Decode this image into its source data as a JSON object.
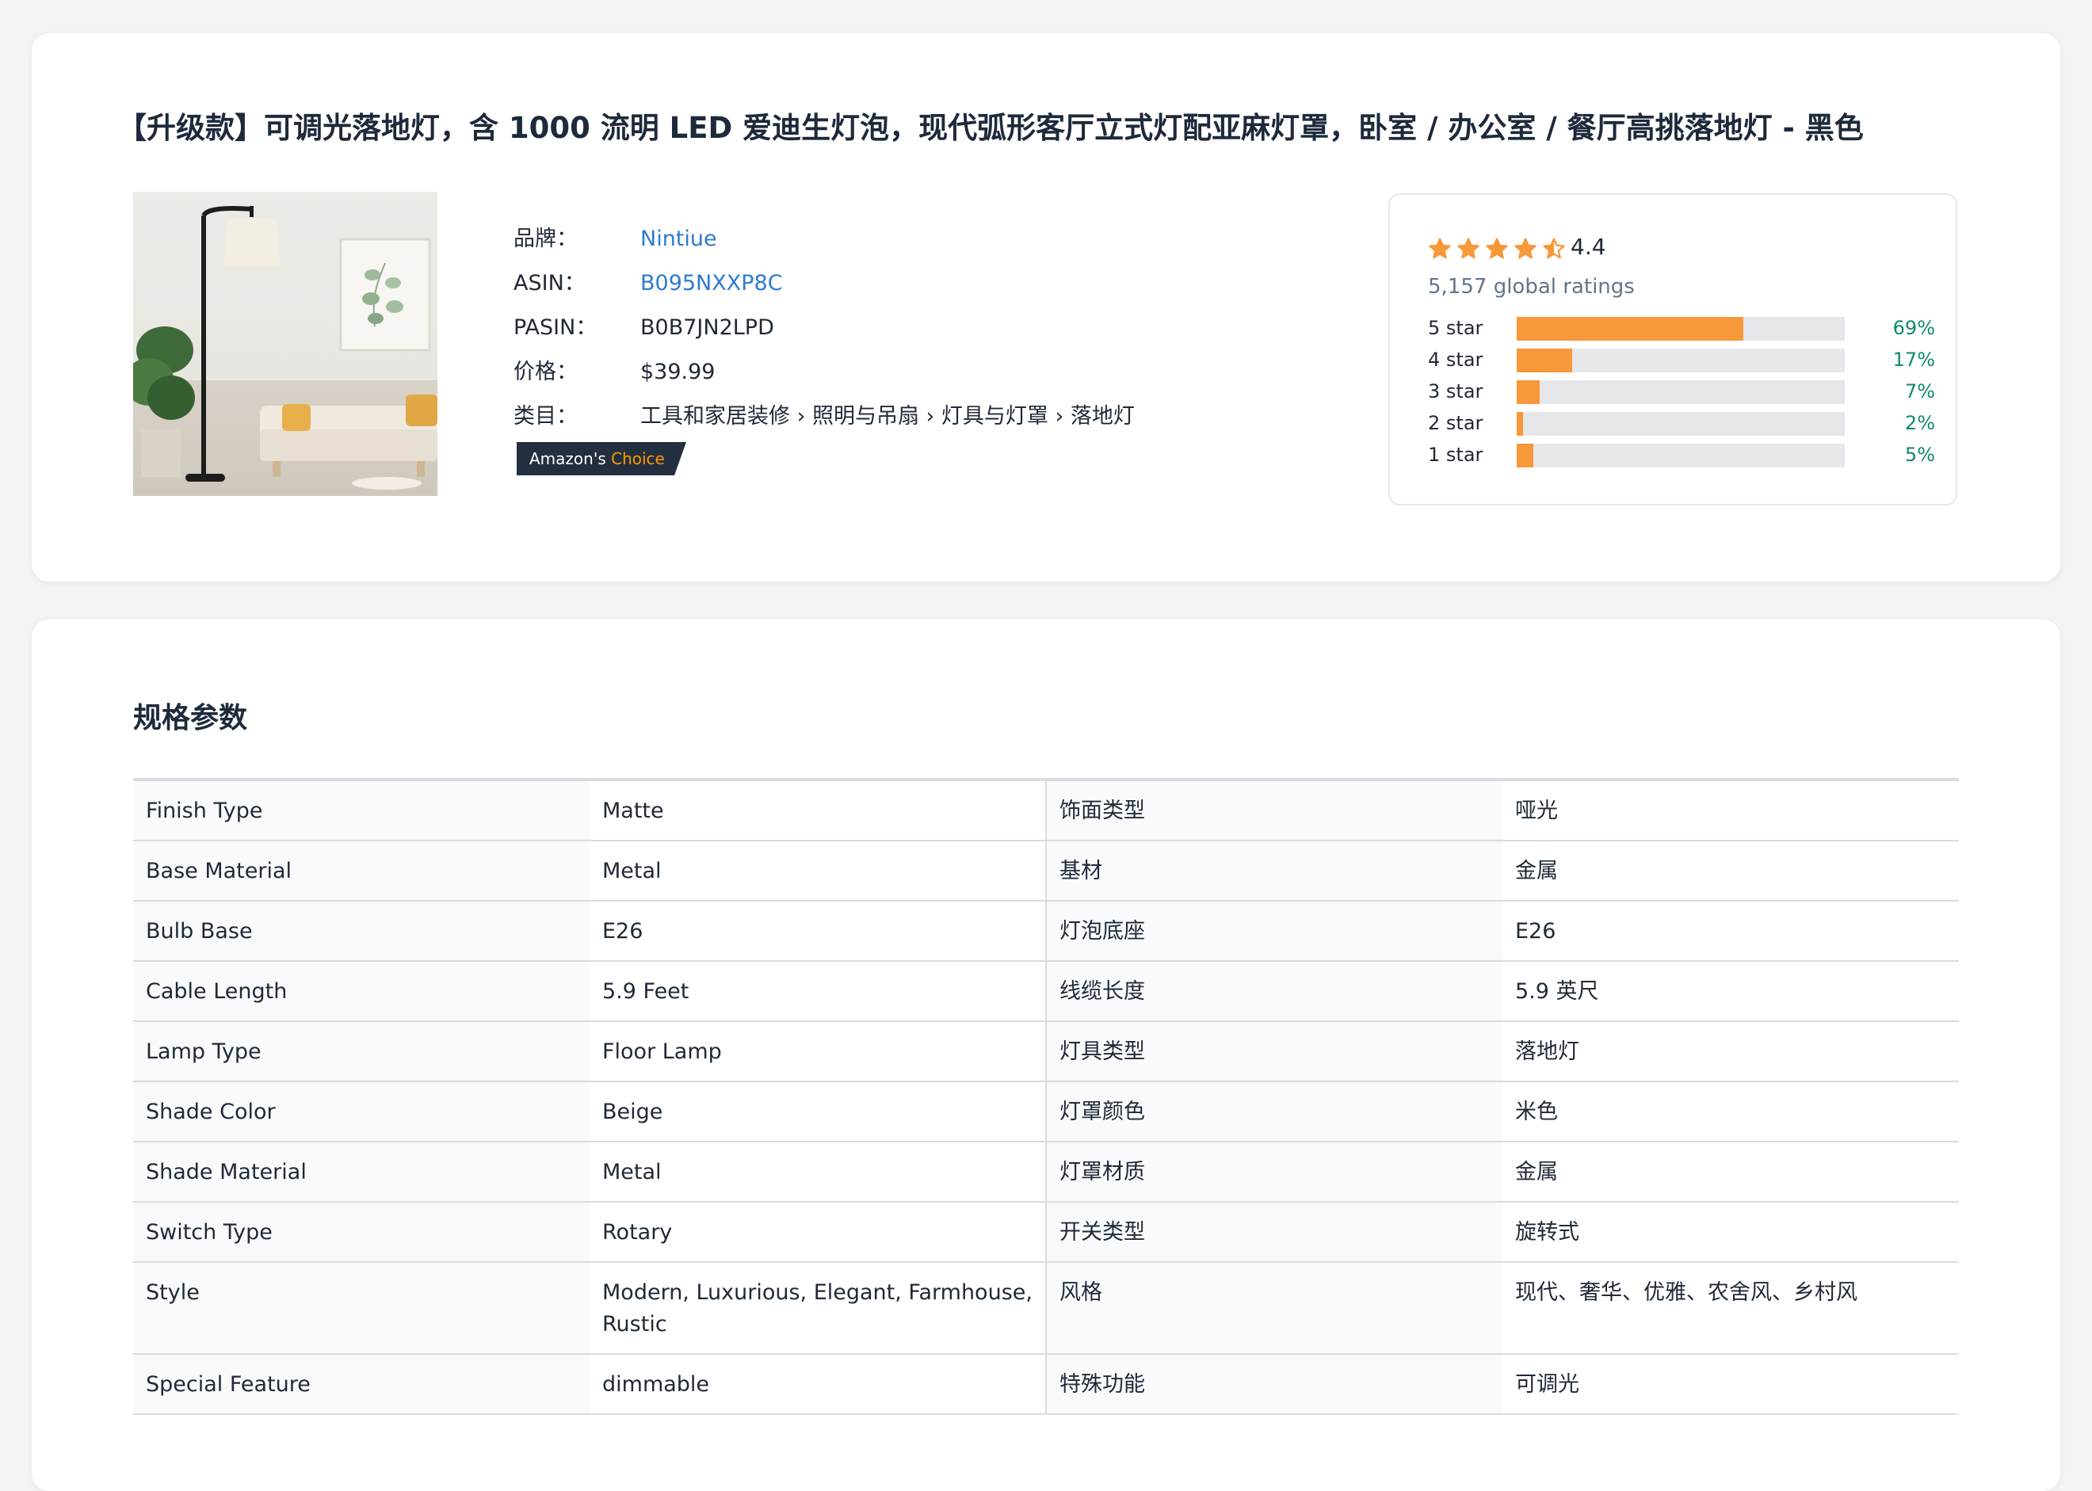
{
  "product": {
    "title": "【升级款】可调光落地灯，含 1000 流明 LED 爱迪生灯泡，现代弧形客厅立式灯配亚麻灯罩，卧室 / 办公室 / 餐厅高挑落地灯 - 黑色",
    "image_alt": "floor-lamp-product-photo",
    "info": [
      {
        "label": "品牌：",
        "value": "Nintiue"
      },
      {
        "label": "ASIN：",
        "value": "B095NXXP8C"
      },
      {
        "label": "PASIN：",
        "value": "B0B7JN2LPD"
      },
      {
        "label": "价格：",
        "value": "$39.99"
      },
      {
        "label": "类目：",
        "value": "工具和家居装修 › 照明与吊扇 › 灯具与灯罩 › 落地灯"
      }
    ],
    "badge": {
      "prefix": "Amazon's",
      "accent": "Choice"
    }
  },
  "rating": {
    "value": "4.4",
    "stars": 4.5,
    "global_ratings": "5,157 global ratings",
    "histogram": [
      {
        "label": "5 star",
        "percent": 69,
        "percent_text": "69%"
      },
      {
        "label": "4 star",
        "percent": 17,
        "percent_text": "17%"
      },
      {
        "label": "3 star",
        "percent": 7,
        "percent_text": "7%"
      },
      {
        "label": "2 star",
        "percent": 2,
        "percent_text": "2%"
      },
      {
        "label": "1 star",
        "percent": 5,
        "percent_text": "5%"
      }
    ]
  },
  "specs": {
    "heading": "规格参数",
    "rows": [
      {
        "en_key": "Finish Type",
        "en_val": "Matte",
        "zh_key": "饰面类型",
        "zh_val": "哑光"
      },
      {
        "en_key": "Base Material",
        "en_val": "Metal",
        "zh_key": "基材",
        "zh_val": "金属"
      },
      {
        "en_key": "Bulb Base",
        "en_val": "E26",
        "zh_key": "灯泡底座",
        "zh_val": "E26"
      },
      {
        "en_key": "Cable Length",
        "en_val": "5.9 Feet",
        "zh_key": "线缆长度",
        "zh_val": "5.9 英尺"
      },
      {
        "en_key": "Lamp Type",
        "en_val": "Floor Lamp",
        "zh_key": "灯具类型",
        "zh_val": "落地灯"
      },
      {
        "en_key": "Shade Color",
        "en_val": "Beige",
        "zh_key": "灯罩颜色",
        "zh_val": "米色"
      },
      {
        "en_key": "Shade Material",
        "en_val": "Metal",
        "zh_key": "灯罩材质",
        "zh_val": "金属"
      },
      {
        "en_key": "Switch Type",
        "en_val": "Rotary",
        "zh_key": "开关类型",
        "zh_val": "旋转式"
      },
      {
        "en_key": "Style",
        "en_val": "Modern, Luxurious, Elegant, Farmhouse, Rustic",
        "zh_key": "风格",
        "zh_val": "现代、奢华、优雅、农舍风、乡村风"
      },
      {
        "en_key": "Special Feature",
        "en_val": "dimmable",
        "zh_key": "特殊功能",
        "zh_val": "可调光"
      }
    ]
  },
  "colors": {
    "star": "#f7983a",
    "bar_fill": "#f7983a",
    "link": "#2f7ad1",
    "percent_text": "#0f8a6c",
    "badge_bg": "#232f3e",
    "badge_accent": "#ff9900"
  }
}
